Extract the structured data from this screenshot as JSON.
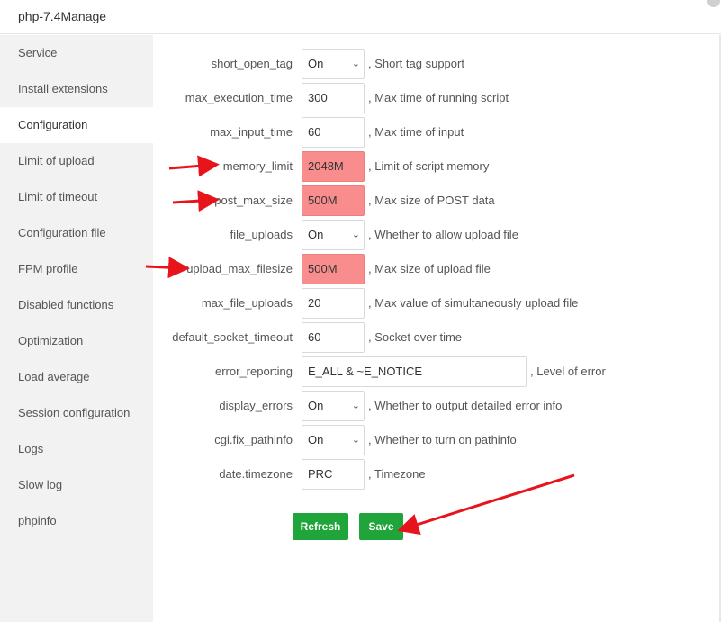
{
  "window": {
    "title": "php-7.4Manage"
  },
  "sidebar": {
    "items": [
      {
        "label": "Service"
      },
      {
        "label": "Install extensions"
      },
      {
        "label": "Configuration"
      },
      {
        "label": "Limit of upload"
      },
      {
        "label": "Limit of timeout"
      },
      {
        "label": "Configuration file"
      },
      {
        "label": "FPM profile"
      },
      {
        "label": "Disabled functions"
      },
      {
        "label": "Optimization"
      },
      {
        "label": "Load average"
      },
      {
        "label": "Session configuration"
      },
      {
        "label": "Logs"
      },
      {
        "label": "Slow log"
      },
      {
        "label": "phpinfo"
      }
    ],
    "active_index": 2
  },
  "config": {
    "rows": [
      {
        "label": "short_open_tag",
        "value": "On",
        "desc": ", Short tag support"
      },
      {
        "label": "max_execution_time",
        "value": "300",
        "desc": ", Max time of running script"
      },
      {
        "label": "max_input_time",
        "value": "60",
        "desc": ", Max time of input"
      },
      {
        "label": "memory_limit",
        "value": "2048M",
        "desc": ", Limit of script memory"
      },
      {
        "label": "post_max_size",
        "value": "500M",
        "desc": ", Max size of POST data"
      },
      {
        "label": "file_uploads",
        "value": "On",
        "desc": ", Whether to allow upload file"
      },
      {
        "label": "upload_max_filesize",
        "value": "500M",
        "desc": ", Max size of upload file"
      },
      {
        "label": "max_file_uploads",
        "value": "20",
        "desc": ", Max value of simultaneously upload file"
      },
      {
        "label": "default_socket_timeout",
        "value": "60",
        "desc": ", Socket over time"
      },
      {
        "label": "error_reporting",
        "value": "E_ALL & ~E_NOTICE",
        "desc": ", Level of error"
      },
      {
        "label": "display_errors",
        "value": "On",
        "desc": ", Whether to output detailed error info"
      },
      {
        "label": "cgi.fix_pathinfo",
        "value": "On",
        "desc": ", Whether to turn on pathinfo"
      },
      {
        "label": "date.timezone",
        "value": "PRC",
        "desc": ", Timezone"
      }
    ]
  },
  "buttons": {
    "refresh_label": "Refresh",
    "save_label": "Save"
  },
  "colors": {
    "accent_green": "#20a53a",
    "highlight_red": "#f98d8d",
    "arrow_red": "#e8141c"
  }
}
